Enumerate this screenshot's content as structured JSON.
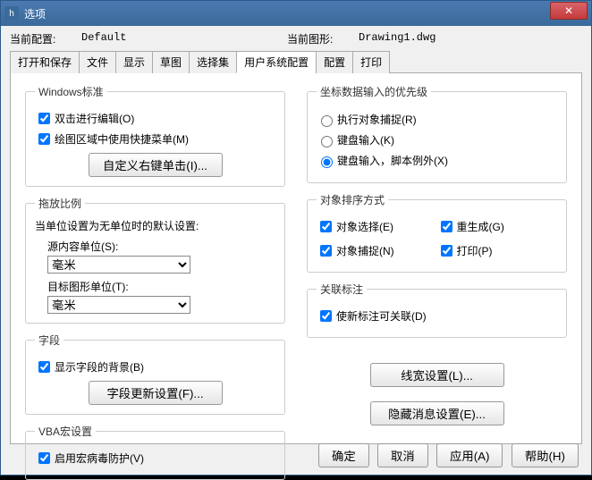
{
  "window": {
    "title": "选项"
  },
  "header": {
    "cur_profile_label": "当前配置:",
    "cur_profile_value": "Default",
    "cur_drawing_label": "当前图形:",
    "cur_drawing_value": "Drawing1.dwg"
  },
  "tabs": [
    "打开和保存",
    "文件",
    "显示",
    "草图",
    "选择集",
    "用户系统配置",
    "配置",
    "打印"
  ],
  "active_tab": "用户系统配置",
  "left": {
    "win_std": {
      "legend": "Windows标准",
      "dblclick_edit": "双击进行编辑(O)",
      "context_menu": "绘图区域中使用快捷菜单(M)",
      "btn_rightclick": "自定义右键单击(I)..."
    },
    "scale": {
      "legend": "拖放比例",
      "desc": "当单位设置为无单位时的默认设置:",
      "src_label": "源内容单位(S):",
      "src_value": "毫米",
      "dst_label": "目标图形单位(T):",
      "dst_value": "毫米"
    },
    "field": {
      "legend": "字段",
      "show_bg": "显示字段的背景(B)",
      "btn_update": "字段更新设置(F)..."
    },
    "vba": {
      "legend": "VBA宏设置",
      "enable": "启用宏病毒防护(V)"
    }
  },
  "right": {
    "coord": {
      "legend": "坐标数据输入的优先级",
      "opt1": "执行对象捕捉(R)",
      "opt2": "键盘输入(K)",
      "opt3": "键盘输入，脚本例外(X)"
    },
    "sort": {
      "legend": "对象排序方式",
      "chk1": "对象选择(E)",
      "chk2": "重生成(G)",
      "chk3": "对象捕捉(N)",
      "chk4": "打印(P)"
    },
    "assoc": {
      "legend": "关联标注",
      "chk": "使新标注可关联(D)"
    },
    "btn_lw": "线宽设置(L)...",
    "btn_hide": "隐藏消息设置(E)..."
  },
  "footer": {
    "ok": "确定",
    "cancel": "取消",
    "apply": "应用(A)",
    "help": "帮助(H)"
  }
}
